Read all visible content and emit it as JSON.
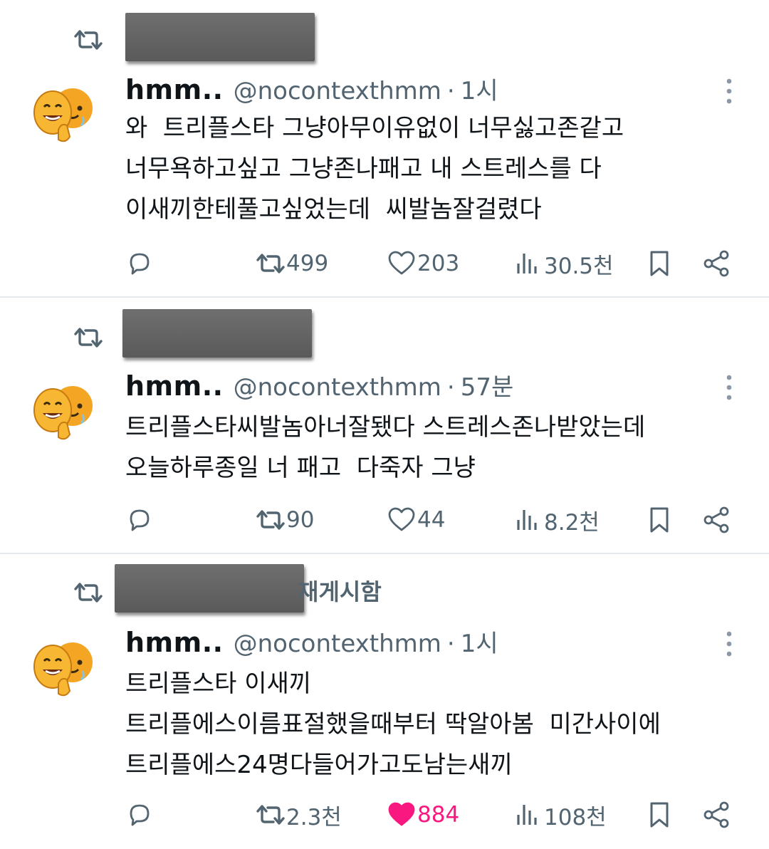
{
  "colors": {
    "text": "#0f1419",
    "muted": "#536471",
    "like_active": "#f91880",
    "divider": "#e6e9ec"
  },
  "posts": [
    {
      "repost_suffix": "",
      "name": "hmm..",
      "handle": "@nocontexthmm",
      "separator": "·",
      "time": "1시",
      "lines": [
        "와  트리플스타 그냥아무이유없이 너무싫고존같고",
        "너무욕하고싶고 그냥존나패고 내 스트레스를 다",
        "이새끼한테풀고싶었는데  씨발놈잘걸렸다"
      ],
      "reply": "",
      "repost": "499",
      "like": "203",
      "views": "30.5천",
      "liked": false
    },
    {
      "repost_suffix": "",
      "name": "hmm..",
      "handle": "@nocontexthmm",
      "separator": "·",
      "time": "57분",
      "lines": [
        "트리플스타씨발놈아너잘됐다 스트레스존나받았는데",
        "오늘하루종일 너 패고  다죽자 그냥"
      ],
      "reply": "",
      "repost": "90",
      "like": "44",
      "views": "8.2천",
      "liked": false
    },
    {
      "repost_suffix": "재게시함",
      "name": "hmm..",
      "handle": "@nocontexthmm",
      "separator": "·",
      "time": "1시",
      "lines": [
        "트리플스타 이새끼",
        "트리플에스이름표절했을때부터 딱알아봄  미간사이에",
        "트리플에스24명다들어가고도남는새끼"
      ],
      "reply": "",
      "repost": "2.3천",
      "like": "884",
      "views": "108천",
      "liked": true
    }
  ],
  "icons": {
    "repost": "repost-icon",
    "reply": "reply-icon",
    "like": "heart-icon",
    "views": "views-icon",
    "bookmark": "bookmark-icon",
    "share": "share-icon",
    "more": "more-vertical-icon",
    "avatar": "emoji-avatar"
  }
}
